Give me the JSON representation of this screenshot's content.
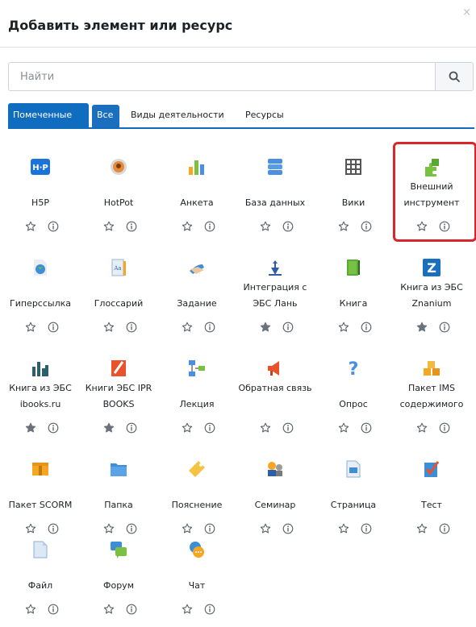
{
  "dialog": {
    "title": "Добавить элемент или ресурс",
    "close": "×"
  },
  "search": {
    "placeholder": "Найти"
  },
  "tabs": [
    {
      "label": "Помеченные"
    },
    {
      "label": "Все"
    },
    {
      "label": "Виды деятельности"
    },
    {
      "label": "Ресурсы"
    }
  ],
  "tiles": [
    {
      "label": "H5P",
      "icon": "h5p-icon",
      "starred": false
    },
    {
      "label": "HotPot",
      "icon": "hotpot-icon",
      "starred": false
    },
    {
      "label": "Анкета",
      "icon": "survey-icon",
      "starred": false
    },
    {
      "label": "База данных",
      "icon": "database-icon",
      "starred": false
    },
    {
      "label": "Вики",
      "icon": "wiki-icon",
      "starred": false
    },
    {
      "label": "Внешний инструмент",
      "icon": "external-tool-icon",
      "starred": false,
      "highlighted": true
    },
    {
      "label": "Гиперссылка",
      "icon": "url-icon",
      "starred": false
    },
    {
      "label": "Глоссарий",
      "icon": "glossary-icon",
      "starred": false
    },
    {
      "label": "Задание",
      "icon": "assignment-icon",
      "starred": false
    },
    {
      "label": "Интеграция с ЭБС Лань",
      "icon": "lan-icon",
      "starred": true
    },
    {
      "label": "Книга",
      "icon": "book-icon",
      "starred": false
    },
    {
      "label": "Книга из ЭБС Znanium",
      "icon": "znanium-icon",
      "starred": true
    },
    {
      "label": "Книга из ЭБС ibooks.ru",
      "icon": "ibooks-icon",
      "starred": true
    },
    {
      "label": "Книги ЭБС IPR BOOKS",
      "icon": "iprbooks-icon",
      "starred": true
    },
    {
      "label": "Лекция",
      "icon": "lesson-icon",
      "starred": false
    },
    {
      "label": "Обратная связь",
      "icon": "feedback-icon",
      "starred": false
    },
    {
      "label": "Опрос",
      "icon": "choice-icon",
      "starred": false
    },
    {
      "label": "Пакет IMS содержимого",
      "icon": "ims-icon",
      "starred": false
    },
    {
      "label": "Пакет SCORM",
      "icon": "scorm-icon",
      "starred": false
    },
    {
      "label": "Папка",
      "icon": "folder-icon",
      "starred": false
    },
    {
      "label": "Пояснение",
      "icon": "label-icon",
      "starred": false
    },
    {
      "label": "Семинар",
      "icon": "workshop-icon",
      "starred": false
    },
    {
      "label": "Страница",
      "icon": "page-icon",
      "starred": false
    },
    {
      "label": "Тест",
      "icon": "quiz-icon",
      "starred": false
    },
    {
      "label": "Файл",
      "icon": "file-icon",
      "starred": false
    },
    {
      "label": "Форум",
      "icon": "forum-icon",
      "starred": false
    },
    {
      "label": "Чат",
      "icon": "chat-icon",
      "starred": false
    }
  ],
  "colors": {
    "accent": "#0f6cbf",
    "highlight": "#d9262c",
    "star_filled": "#6a737b"
  }
}
